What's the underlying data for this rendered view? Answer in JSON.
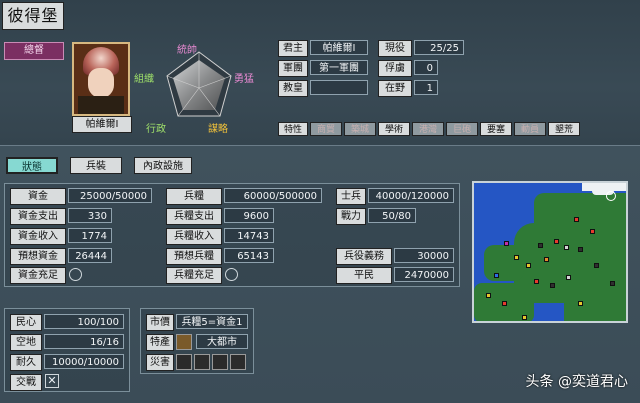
{
  "castle": {
    "title": "彼得堡"
  },
  "commander": {
    "role": "總督",
    "name": "帕維爾Ⅰ",
    "radar_labels": {
      "top": "統帥",
      "left": "組織",
      "right": "勇猛",
      "bottom_left": "行政",
      "bottom_right": "謀略"
    }
  },
  "info": {
    "ruler_label": "君主",
    "ruler_value": "帕維爾Ⅰ",
    "corps_label": "軍團",
    "corps_value": "第一軍團",
    "pope_label": "教皇",
    "pope_value": "",
    "active_label": "現役",
    "active_value": "25/25",
    "captive_label": "俘虜",
    "captive_value": "0",
    "wild_label": "在野",
    "wild_value": "1"
  },
  "traits": {
    "label": "特性",
    "items": [
      {
        "text": "商貿",
        "on": false
      },
      {
        "text": "築城",
        "on": false
      },
      {
        "text": "學術",
        "on": true
      },
      {
        "text": "港灣",
        "on": false
      },
      {
        "text": "巨砲",
        "on": false
      },
      {
        "text": "要塞",
        "on": true
      },
      {
        "text": "動員",
        "on": false
      },
      {
        "text": "墾荒",
        "on": true
      }
    ]
  },
  "tabs": [
    {
      "label": "狀態",
      "active": true
    },
    {
      "label": "兵裝",
      "active": false
    },
    {
      "label": "內政設施",
      "active": false
    }
  ],
  "funds": {
    "rows": [
      {
        "label": "資金",
        "value": "25000/50000"
      },
      {
        "label": "資金支出",
        "value": "330"
      },
      {
        "label": "資金收入",
        "value": "1774"
      },
      {
        "label": "預想資金",
        "value": "26444"
      }
    ],
    "sufficient_label": "資金充足"
  },
  "provisions": {
    "rows": [
      {
        "label": "兵糧",
        "value": "60000/500000"
      },
      {
        "label": "兵糧支出",
        "value": "9600"
      },
      {
        "label": "兵糧收入",
        "value": "14743"
      },
      {
        "label": "預想兵糧",
        "value": "65143"
      }
    ],
    "sufficient_label": "兵糧充足"
  },
  "military": {
    "soldiers_label": "士兵",
    "soldiers_value": "40000/120000",
    "power_label": "戰力",
    "power_value": "50/80",
    "service_label": "兵役義務",
    "service_value": "30000",
    "civilians_label": "平民",
    "civilians_value": "2470000"
  },
  "city": {
    "morale_label": "民心",
    "morale_value": "100/100",
    "land_label": "空地",
    "land_value": "16/16",
    "durability_label": "耐久",
    "durability_value": "10000/10000",
    "battle_label": "交戰"
  },
  "market": {
    "price_label": "市價",
    "price_value": "兵糧5=資金1",
    "specialty_label": "特產",
    "specialty_value": "大都市",
    "disaster_label": "災害"
  },
  "watermark": "头条 @奕道君心",
  "colors": {
    "accent": "#86d9d2",
    "badge": "#7b2f62",
    "map_ocean": "#2556c4",
    "map_land": "#2f7a36"
  }
}
